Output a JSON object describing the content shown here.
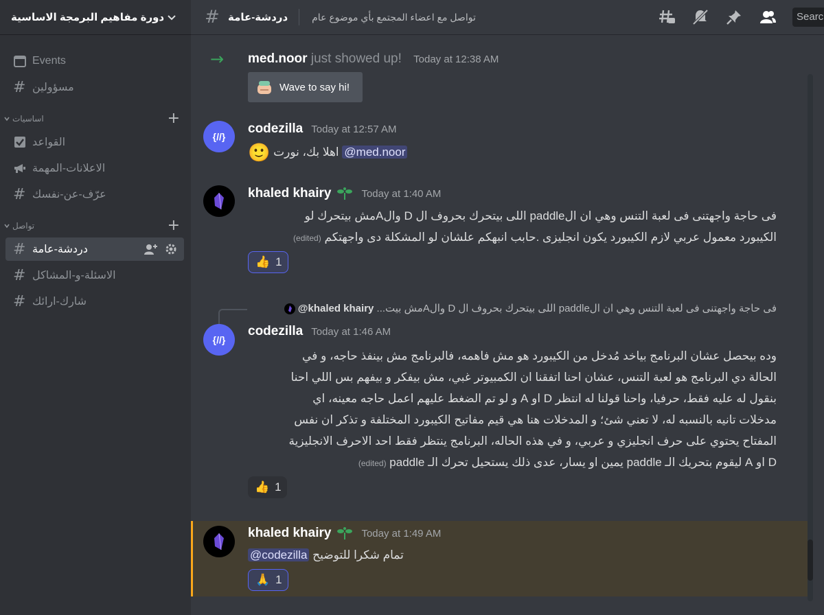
{
  "server": {
    "name": "دورة مفاهيم البرمجة الاساسية"
  },
  "sidebar": {
    "top_items": [
      {
        "label": "Events",
        "icon": "calendar-icon"
      },
      {
        "label": "مسؤولين",
        "icon": "locked-hash-icon"
      }
    ],
    "categories": [
      {
        "label": "اساسيات",
        "channels": [
          {
            "label": "القواعد",
            "icon": "rules-checkbox-icon"
          },
          {
            "label": "الاعلانات-المهمة",
            "icon": "megaphone-icon"
          },
          {
            "label": "عرّف-عن-نفسك",
            "icon": "hash-icon"
          }
        ]
      },
      {
        "label": "تواصل",
        "channels": [
          {
            "label": "دردشة-عامة",
            "icon": "hash-icon",
            "active": true
          },
          {
            "label": "الاسئلة-و-المشاكل",
            "icon": "hash-icon"
          },
          {
            "label": "شارك-ارائك",
            "icon": "hash-icon"
          }
        ]
      }
    ]
  },
  "topbar": {
    "channel_name": "دردشة-عامة",
    "topic": "تواصل مع اعضاء المجتمع بأي موضوع عام",
    "search_placeholder": "Search"
  },
  "messages": {
    "join": {
      "user": "med.noor",
      "text": "just showed up!",
      "time": "Today at 12:38 AM",
      "wave_label": "Wave to say hi!"
    },
    "m1": {
      "author": "codezilla",
      "time": "Today at 12:57 AM",
      "mention": "@med.noor",
      "text": "اهلا  بك، نورت",
      "emoji": "🙂"
    },
    "m2": {
      "author": "khaled khairy",
      "time": "Today at 1:40 AM",
      "line1": "فى حاجة واجهتنى فى لعبة التنس وهي ان الpaddle اللى بيتحرك بحروف ال D والAمش بيتحرك لو",
      "line2": "الكيبورد معمول عربي لازم الكيبورد يكون انجليزى .حابب انبهكم علشان لو المشكلة دى واجهتكم",
      "edited": "(edited)",
      "reaction_emoji": "👍",
      "reaction_count": "1"
    },
    "m3": {
      "reply_author": "@khaled khairy",
      "reply_text": "فى حاجة واجهتنى فى لعبة التنس وهي ان الpaddle اللى بيتحرك بحروف ال D والAمش بيت...",
      "author": "codezilla",
      "time": "Today at 1:46 AM",
      "lines": [
        "وده بيحصل عشان البرنامج بياخد مُدخل من الكيبورد هو مش فاهمه، فالبرنامج مش بينفذ حاجه، و في",
        "الحالة دي البرنامج هو لعبة التنس، عشان احنا اتفقنا ان الكمبيوتر غبي، مش بيفكر و بيفهم بس اللي احنا",
        "بنقول له عليه فقط، حرفيا، واحنا قولنا له انتظر D او A و لو تم الضغط عليهم اعمل حاجه معينه، اي",
        "مدخلات تانيه بالنسبه له، لا تعني شئ؛ و المدخلات هنا هي قيم مفاتيح الكيبورد المختلفة و تذكر ان نفس",
        "المفتاح يحتوي على حرف انجليزي و عربي، و في هذه الحاله،  البرنامج ينتظر فقط احد الاحرف الانجليزية",
        "D او A ليقوم بتحريك الـ paddle يمين او يسار، عدى ذلك يستحيل تحرك الـ paddle"
      ],
      "edited": "(edited)",
      "reaction_emoji": "👍",
      "reaction_count": "1"
    },
    "m4": {
      "author": "khaled khairy",
      "time": "Today at 1:49 AM",
      "text": "تمام شكرا للتوضيح",
      "mention": "@codezilla",
      "reaction_emoji": "🙏",
      "reaction_count": "1"
    }
  },
  "avatars": {
    "codezilla": "{//}"
  },
  "colors": {
    "accent": "#5865f2",
    "online_green": "#3ba55c",
    "highlight_border": "#faa81a"
  }
}
